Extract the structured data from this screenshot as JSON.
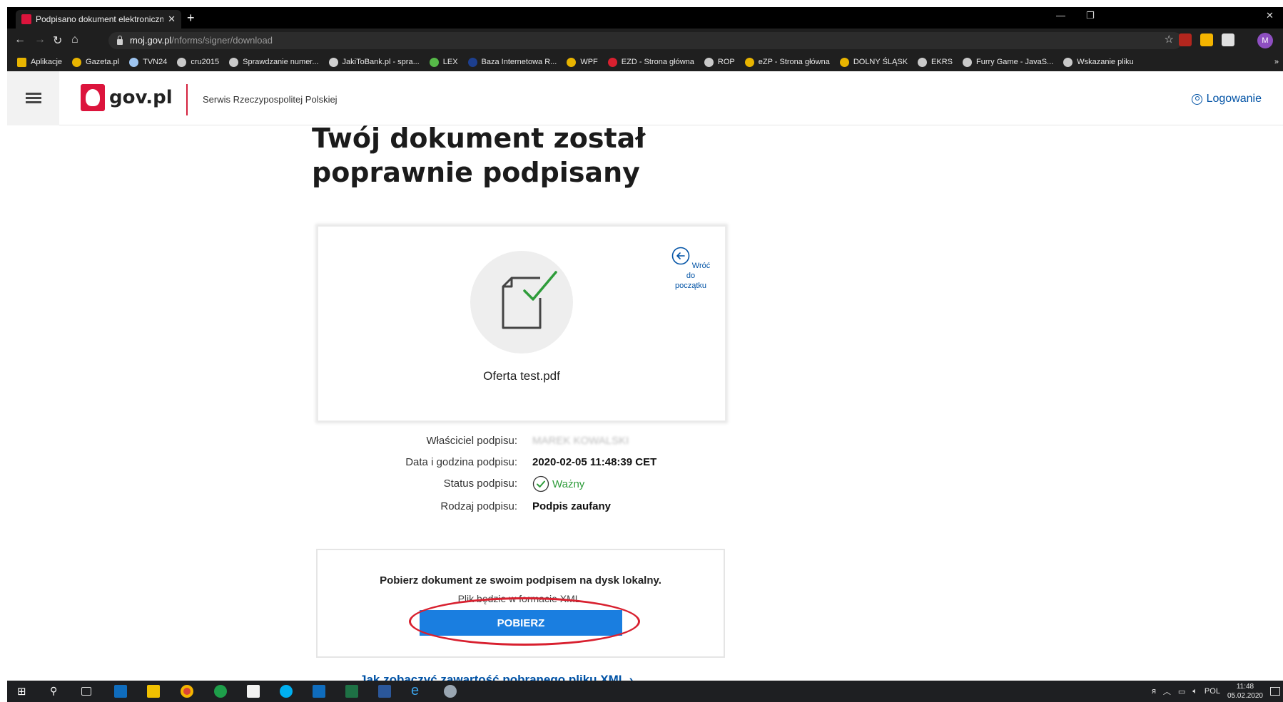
{
  "browser": {
    "tab_title": "Podpisano dokument elektroniczn",
    "new_tab": "+",
    "url_host": "moj.gov.pl",
    "url_path": "/nforms/signer/download",
    "profile_initial": "M",
    "bookmarks": [
      {
        "label": "Aplikacje",
        "icon": "apps-grid-icon",
        "color": "#e8b400"
      },
      {
        "label": "Gazeta.pl",
        "icon": "gazeta-icon",
        "color": "#e8b400"
      },
      {
        "label": "TVN24",
        "icon": "tvn24-icon",
        "color": "#9ec5f0"
      },
      {
        "label": "cru2015",
        "icon": "globe-icon",
        "color": "#c9c9c9"
      },
      {
        "label": "Sprawdzanie numer...",
        "icon": "globe-icon",
        "color": "#c9c9c9"
      },
      {
        "label": "JakiToBank.pl - spra...",
        "icon": "jakitobank-icon",
        "color": "#d0d0d0"
      },
      {
        "label": "LEX",
        "icon": "lex-icon",
        "color": "#56b948"
      },
      {
        "label": "Baza Internetowa R...",
        "icon": "baza-icon",
        "color": "#1d3f8f"
      },
      {
        "label": "WPF",
        "icon": "crest-icon",
        "color": "#e8b400"
      },
      {
        "label": "EZD - Strona główna",
        "icon": "ezd-icon",
        "color": "#d8202f"
      },
      {
        "label": "ROP",
        "icon": "globe-icon",
        "color": "#c9c9c9"
      },
      {
        "label": "eZP - Strona główna",
        "icon": "crest-icon",
        "color": "#e8b400"
      },
      {
        "label": "DOLNY ŚLĄSK",
        "icon": "crest-icon",
        "color": "#e8b400"
      },
      {
        "label": "EKRS",
        "icon": "eagle-icon",
        "color": "#c9c9c9"
      },
      {
        "label": "Furry Game - JavaS...",
        "icon": "globe-icon",
        "color": "#c9c9c9"
      },
      {
        "label": "Wskazanie pliku",
        "icon": "globe-icon",
        "color": "#c9c9c9"
      }
    ],
    "bookmarks_overflow": "»"
  },
  "site": {
    "logo_text": "gov.pl",
    "subtitle": "Serwis Rzeczypospolitej Polskiej",
    "login_label": "Logowanie"
  },
  "main": {
    "title_line1": "Twój dokument został",
    "title_line2": "poprawnie podpisany",
    "back_link_line1": "Wróć do",
    "back_link_line2": "początku",
    "filename": "Oferta test.pdf",
    "details": [
      {
        "label": "Właściciel podpisu:",
        "value": "MAREK KOWALSKI",
        "style": "blurred"
      },
      {
        "label": "Data i godzina podpisu:",
        "value": "2020-02-05 11:48:39 CET",
        "style": "bold"
      },
      {
        "label": "Status podpisu:",
        "value": "Ważny",
        "style": "status"
      },
      {
        "label": "Rodzaj podpisu:",
        "value": "Podpis zaufany",
        "style": "bold"
      }
    ],
    "download_title": "Pobierz dokument ze swoim podpisem na dysk lokalny.",
    "download_sub": "Plik będzie w formacie XML.",
    "download_button": "POBIERZ",
    "help_link": "Jak zobaczyć zawartość pobranego pliku XML ›"
  },
  "taskbar": {
    "language": "POL",
    "time": "11:48",
    "date": "05.02.2020"
  },
  "colors": {
    "accent_blue": "#0052a5",
    "button_blue": "#1a7ee0",
    "success_green": "#2e9c3a",
    "gov_red": "#d4213d",
    "highlight_red": "#d8202f"
  }
}
